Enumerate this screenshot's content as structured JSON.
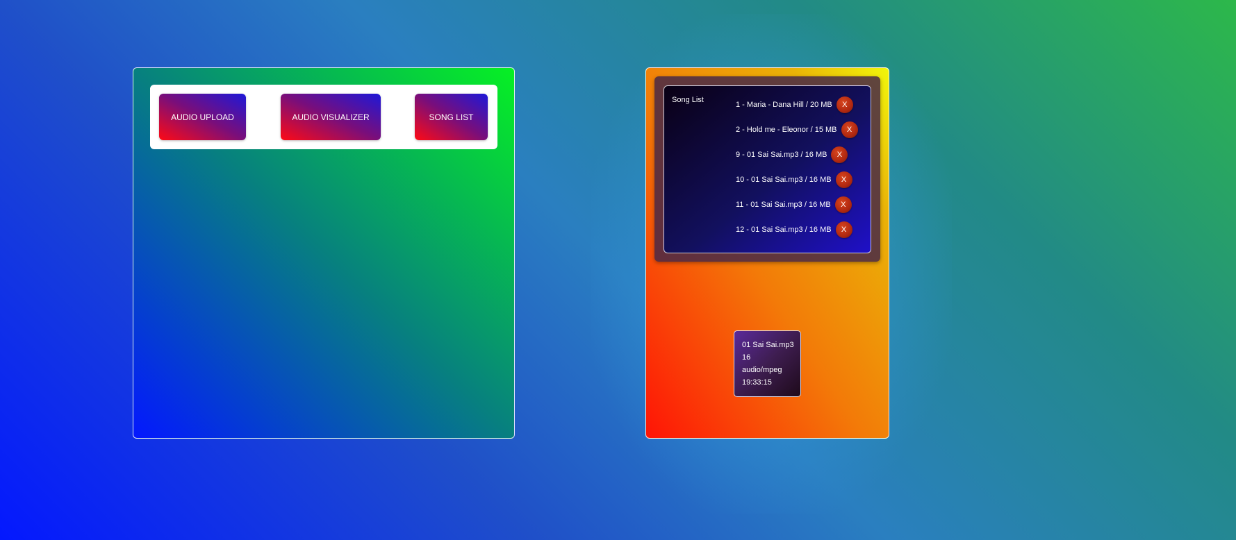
{
  "nav": {
    "buttons": [
      {
        "label": "AUDIO UPLOAD"
      },
      {
        "label": "AUDIO VISUALIZER"
      },
      {
        "label": "SONG LIST"
      }
    ]
  },
  "song_list": {
    "title": "Song List",
    "delete_label": "X",
    "items": [
      {
        "label": "1 - Maria - Dana Hill / 20 MB"
      },
      {
        "label": "2 - Hold me - Eleonor / 15 MB"
      },
      {
        "label": "9 - 01 Sai Sai.mp3 / 16 MB"
      },
      {
        "label": "10 - 01 Sai Sai.mp3 / 16 MB"
      },
      {
        "label": "11 - 01 Sai Sai.mp3 / 16 MB"
      },
      {
        "label": "12 - 01 Sai Sai.mp3 / 16 MB"
      }
    ]
  },
  "file_info": {
    "name": "01 Sai Sai.mp3",
    "size": "16",
    "type": "audio/mpeg",
    "time": "19:33:15"
  },
  "colors": {
    "button_gradient_start": "#ff0a14",
    "button_gradient_end": "#1e18d8",
    "delete_button": "#b02810",
    "left_panel_gradient": [
      "#0418ff",
      "#06f123"
    ],
    "right_panel_gradient": [
      "#ff1406",
      "#f1f70a"
    ]
  }
}
